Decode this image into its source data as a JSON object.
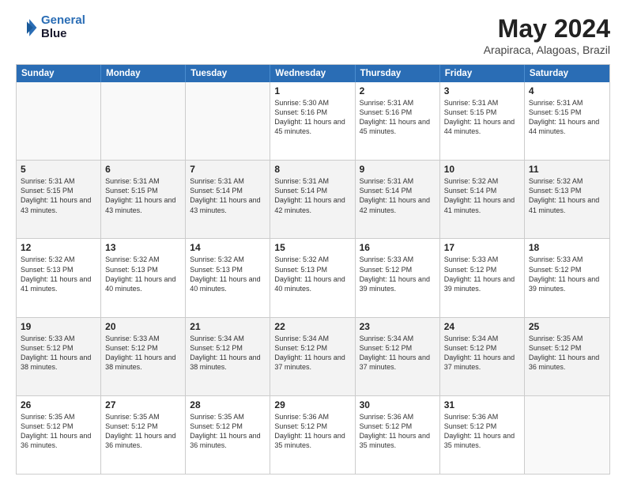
{
  "header": {
    "logo_line1": "General",
    "logo_line2": "Blue",
    "month": "May 2024",
    "location": "Arapiraca, Alagoas, Brazil"
  },
  "weekdays": [
    "Sunday",
    "Monday",
    "Tuesday",
    "Wednesday",
    "Thursday",
    "Friday",
    "Saturday"
  ],
  "weeks": [
    [
      {
        "day": "",
        "info": ""
      },
      {
        "day": "",
        "info": ""
      },
      {
        "day": "",
        "info": ""
      },
      {
        "day": "1",
        "info": "Sunrise: 5:30 AM\nSunset: 5:16 PM\nDaylight: 11 hours\nand 45 minutes."
      },
      {
        "day": "2",
        "info": "Sunrise: 5:31 AM\nSunset: 5:16 PM\nDaylight: 11 hours\nand 45 minutes."
      },
      {
        "day": "3",
        "info": "Sunrise: 5:31 AM\nSunset: 5:15 PM\nDaylight: 11 hours\nand 44 minutes."
      },
      {
        "day": "4",
        "info": "Sunrise: 5:31 AM\nSunset: 5:15 PM\nDaylight: 11 hours\nand 44 minutes."
      }
    ],
    [
      {
        "day": "5",
        "info": "Sunrise: 5:31 AM\nSunset: 5:15 PM\nDaylight: 11 hours\nand 43 minutes."
      },
      {
        "day": "6",
        "info": "Sunrise: 5:31 AM\nSunset: 5:15 PM\nDaylight: 11 hours\nand 43 minutes."
      },
      {
        "day": "7",
        "info": "Sunrise: 5:31 AM\nSunset: 5:14 PM\nDaylight: 11 hours\nand 43 minutes."
      },
      {
        "day": "8",
        "info": "Sunrise: 5:31 AM\nSunset: 5:14 PM\nDaylight: 11 hours\nand 42 minutes."
      },
      {
        "day": "9",
        "info": "Sunrise: 5:31 AM\nSunset: 5:14 PM\nDaylight: 11 hours\nand 42 minutes."
      },
      {
        "day": "10",
        "info": "Sunrise: 5:32 AM\nSunset: 5:14 PM\nDaylight: 11 hours\nand 41 minutes."
      },
      {
        "day": "11",
        "info": "Sunrise: 5:32 AM\nSunset: 5:13 PM\nDaylight: 11 hours\nand 41 minutes."
      }
    ],
    [
      {
        "day": "12",
        "info": "Sunrise: 5:32 AM\nSunset: 5:13 PM\nDaylight: 11 hours\nand 41 minutes."
      },
      {
        "day": "13",
        "info": "Sunrise: 5:32 AM\nSunset: 5:13 PM\nDaylight: 11 hours\nand 40 minutes."
      },
      {
        "day": "14",
        "info": "Sunrise: 5:32 AM\nSunset: 5:13 PM\nDaylight: 11 hours\nand 40 minutes."
      },
      {
        "day": "15",
        "info": "Sunrise: 5:32 AM\nSunset: 5:13 PM\nDaylight: 11 hours\nand 40 minutes."
      },
      {
        "day": "16",
        "info": "Sunrise: 5:33 AM\nSunset: 5:12 PM\nDaylight: 11 hours\nand 39 minutes."
      },
      {
        "day": "17",
        "info": "Sunrise: 5:33 AM\nSunset: 5:12 PM\nDaylight: 11 hours\nand 39 minutes."
      },
      {
        "day": "18",
        "info": "Sunrise: 5:33 AM\nSunset: 5:12 PM\nDaylight: 11 hours\nand 39 minutes."
      }
    ],
    [
      {
        "day": "19",
        "info": "Sunrise: 5:33 AM\nSunset: 5:12 PM\nDaylight: 11 hours\nand 38 minutes."
      },
      {
        "day": "20",
        "info": "Sunrise: 5:33 AM\nSunset: 5:12 PM\nDaylight: 11 hours\nand 38 minutes."
      },
      {
        "day": "21",
        "info": "Sunrise: 5:34 AM\nSunset: 5:12 PM\nDaylight: 11 hours\nand 38 minutes."
      },
      {
        "day": "22",
        "info": "Sunrise: 5:34 AM\nSunset: 5:12 PM\nDaylight: 11 hours\nand 37 minutes."
      },
      {
        "day": "23",
        "info": "Sunrise: 5:34 AM\nSunset: 5:12 PM\nDaylight: 11 hours\nand 37 minutes."
      },
      {
        "day": "24",
        "info": "Sunrise: 5:34 AM\nSunset: 5:12 PM\nDaylight: 11 hours\nand 37 minutes."
      },
      {
        "day": "25",
        "info": "Sunrise: 5:35 AM\nSunset: 5:12 PM\nDaylight: 11 hours\nand 36 minutes."
      }
    ],
    [
      {
        "day": "26",
        "info": "Sunrise: 5:35 AM\nSunset: 5:12 PM\nDaylight: 11 hours\nand 36 minutes."
      },
      {
        "day": "27",
        "info": "Sunrise: 5:35 AM\nSunset: 5:12 PM\nDaylight: 11 hours\nand 36 minutes."
      },
      {
        "day": "28",
        "info": "Sunrise: 5:35 AM\nSunset: 5:12 PM\nDaylight: 11 hours\nand 36 minutes."
      },
      {
        "day": "29",
        "info": "Sunrise: 5:36 AM\nSunset: 5:12 PM\nDaylight: 11 hours\nand 35 minutes."
      },
      {
        "day": "30",
        "info": "Sunrise: 5:36 AM\nSunset: 5:12 PM\nDaylight: 11 hours\nand 35 minutes."
      },
      {
        "day": "31",
        "info": "Sunrise: 5:36 AM\nSunset: 5:12 PM\nDaylight: 11 hours\nand 35 minutes."
      },
      {
        "day": "",
        "info": ""
      }
    ]
  ]
}
